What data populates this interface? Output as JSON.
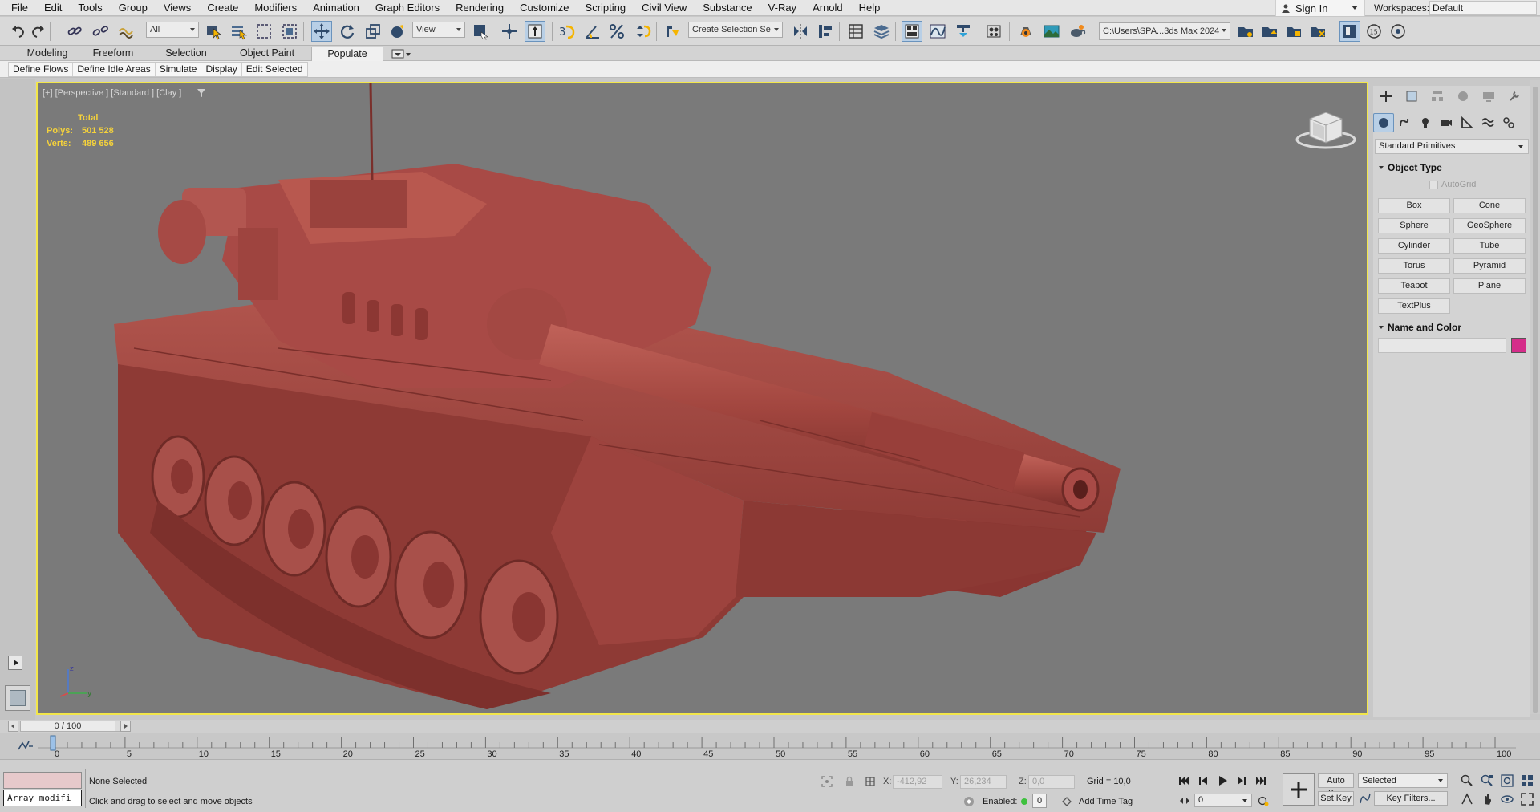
{
  "menubar": {
    "items": [
      "File",
      "Edit",
      "Tools",
      "Group",
      "Views",
      "Create",
      "Modifiers",
      "Animation",
      "Graph Editors",
      "Rendering",
      "Customize",
      "Scripting",
      "Civil View",
      "Substance",
      "V-Ray",
      "Arnold",
      "Help"
    ],
    "sign_in": "Sign In",
    "workspaces_label": "Workspaces:",
    "workspace": "Default"
  },
  "toolbar": {
    "selection_filter": "All",
    "ref_coord": "View",
    "named_selection": "Create Selection Se",
    "project_path": "C:\\Users\\SPA...3ds Max 2024"
  },
  "ribbon": {
    "tabs": [
      "Modeling",
      "Freeform",
      "Selection",
      "Object Paint",
      "Populate"
    ],
    "active_tab": "Populate",
    "populate_buttons": [
      "Define Flows",
      "Define Idle Areas",
      "Simulate",
      "Display",
      "Edit Selected"
    ]
  },
  "viewport": {
    "label": "[+] [Perspective ] [Standard ] [Clay ]",
    "stats": {
      "title": "Total",
      "polys_label": "Polys:",
      "polys": "501 528",
      "verts_label": "Verts:",
      "verts": "489 656"
    },
    "border_color": "#f2e64a",
    "model_color": "#a84a46"
  },
  "command_panel": {
    "primitive_type": "Standard Primitives",
    "object_type_title": "Object Type",
    "autogrid": "AutoGrid",
    "primitives": [
      "Box",
      "Cone",
      "Sphere",
      "GeoSphere",
      "Cylinder",
      "Tube",
      "Torus",
      "Pyramid",
      "Teapot",
      "Plane",
      "TextPlus"
    ],
    "name_color_title": "Name and Color",
    "object_color": "#d52d8a"
  },
  "time_slider": {
    "position": "0 / 100"
  },
  "trackbar": {
    "ticks": [
      "0",
      "5",
      "10",
      "15",
      "20",
      "25",
      "30",
      "35",
      "40",
      "45",
      "50",
      "55",
      "60",
      "65",
      "70",
      "75",
      "80",
      "85",
      "90",
      "95",
      "100"
    ]
  },
  "status": {
    "maxscript_text": "Array modifi",
    "selection": "None Selected",
    "prompt": "Click and drag to select and move objects",
    "x_label": "X:",
    "x": "-412,92",
    "y_label": "Y:",
    "y": "26,234",
    "z_label": "Z:",
    "z": "0,0",
    "grid": "Grid = 10,0",
    "enabled_label": "Enabled:",
    "enabled_value": "0",
    "add_time_tag": "Add Time Tag",
    "auto_key": "Auto Key",
    "set_key": "Set Key",
    "key_mode": "Selected",
    "key_filters": "Key Filters...",
    "current_frame": "0"
  }
}
